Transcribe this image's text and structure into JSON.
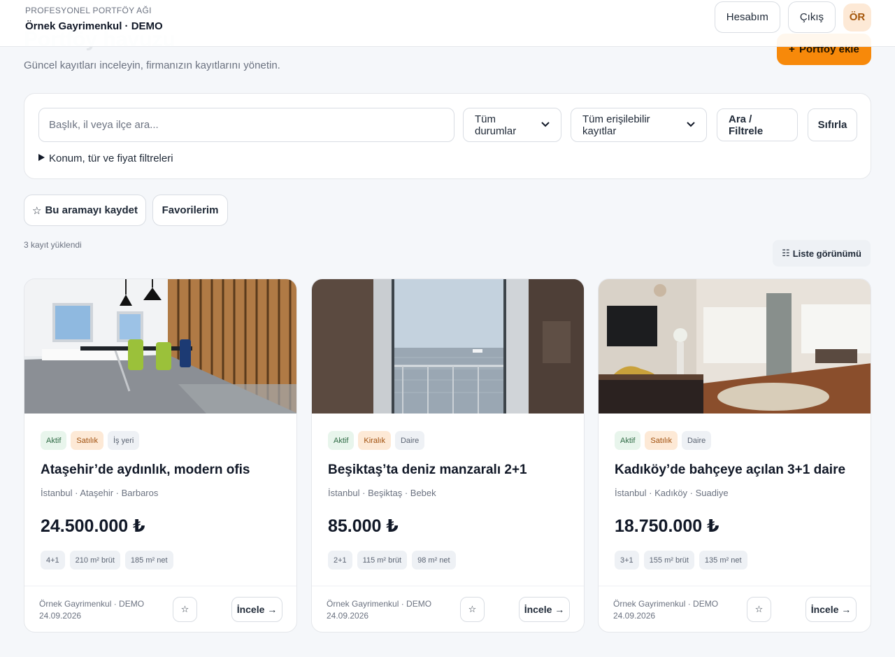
{
  "header": {
    "subtitle": "PROFESYONEL PORTFÖY AĞI",
    "company": "Örnek Gayrimenkul · DEMO",
    "account_label": "Hesabım",
    "logout_label": "Çıkış",
    "avatar_initials": "ÖR"
  },
  "page": {
    "title": "Portföy havuzu",
    "subtitle": "Güncel kayıtları inceleyin, firmanızın kayıtlarını yönetin.",
    "add_icon": "+",
    "add_label": "Portföy ekle"
  },
  "filters": {
    "search_placeholder": "Başlık, il veya ilçe ara...",
    "status_selected": "Tüm durumlar",
    "access_selected": "Tüm erişilebilir kayıtlar",
    "search_button": "Ara / Filtrele",
    "reset_button": "Sıfırla",
    "advanced_toggle": "Konum, tür ve fiyat filtreleri"
  },
  "actions": {
    "save_search_icon": "☆",
    "save_search_label": "Bu aramayı kaydet",
    "favorites_label": "Favorilerim"
  },
  "results": {
    "count_text": "3 kayıt yüklendi",
    "view_icon": "☷",
    "view_toggle_label": "Liste görünümü"
  },
  "listings": [
    {
      "status": "Aktif",
      "deal": "Satılık",
      "type": "İş yeri",
      "title": "Ataşehir’de aydınlık, modern ofis",
      "location": "İstanbul · Ataşehir · Barbaros",
      "price": "24.500.000 ₺",
      "rooms": "4+1",
      "gross": "210 m² brüt",
      "net": "185 m² net",
      "agency": "Örnek Gayrimenkul · DEMO",
      "date": "24.09.2026",
      "view_label": "İncele →"
    },
    {
      "status": "Aktif",
      "deal": "Kiralık",
      "type": "Daire",
      "title": "Beşiktaş’ta deniz manzaralı 2+1",
      "location": "İstanbul · Beşiktaş · Bebek",
      "price": "85.000 ₺",
      "rooms": "2+1",
      "gross": "115 m² brüt",
      "net": "98 m² net",
      "agency": "Örnek Gayrimenkul · DEMO",
      "date": "24.09.2026",
      "view_label": "İncele →"
    },
    {
      "status": "Aktif",
      "deal": "Satılık",
      "type": "Daire",
      "title": "Kadıköy’de bahçeye açılan 3+1 daire",
      "location": "İstanbul · Kadıköy · Suadiye",
      "price": "18.750.000 ₺",
      "rooms": "3+1",
      "gross": "155 m² brüt",
      "net": "135 m² net",
      "agency": "Örnek Gayrimenkul · DEMO",
      "date": "24.09.2026",
      "view_label": "İncele →"
    }
  ],
  "icons": {
    "star": "☆"
  },
  "colors": {
    "accent": "#f7890a",
    "badge_active_bg": "#e8f5ec",
    "badge_deal_bg": "#fde9d6",
    "avatar_bg": "#fde9d6"
  }
}
